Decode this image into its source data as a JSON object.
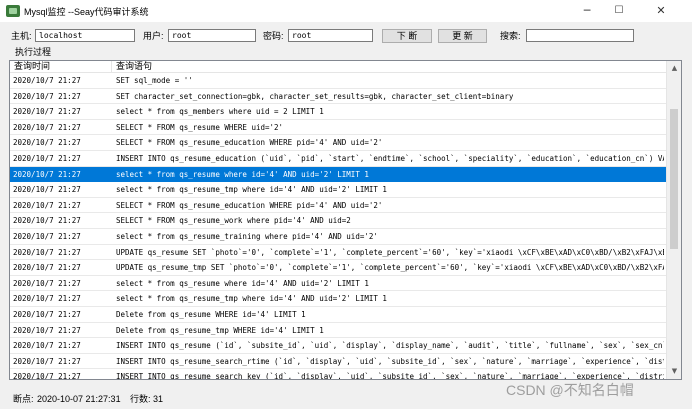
{
  "window": {
    "title": "Mysql监控 --Seay代码审计系统"
  },
  "connection": {
    "host_label": "主机:",
    "host_value": "localhost",
    "user_label": "用户:",
    "user_value": "root",
    "password_label": "密码:",
    "password_value": "root",
    "break_button": "下 断",
    "update_button": "更 新",
    "search_label": "搜索:",
    "search_value": ""
  },
  "log": {
    "section_label": "执行过程",
    "columns": [
      "查询时间",
      "查询语句"
    ],
    "selected_index": 6,
    "rows": [
      {
        "time": "2020/10/7 21:27",
        "sql": "SET sql_mode = ''"
      },
      {
        "time": "2020/10/7 21:27",
        "sql": "SET character_set_connection=gbk, character_set_results=gbk, character_set_client=binary"
      },
      {
        "time": "2020/10/7 21:27",
        "sql": "select * from qs_members where uid = 2 LIMIT 1"
      },
      {
        "time": "2020/10/7 21:27",
        "sql": "SELECT * FROM qs_resume WHERE uid='2'"
      },
      {
        "time": "2020/10/7 21:27",
        "sql": "SELECT * FROM qs_resume_education WHERE  pid='4' AND uid='2'"
      },
      {
        "time": "2020/10/7 21:27",
        "sql": "INSERT INTO qs_resume_education (`uid`, `pid`, `start`, `endtime`, `school`, `speciality`, `education`, `education_cn`) VALUES ('2',..."
      },
      {
        "time": "2020/10/7 21:27",
        "sql": "select * from qs_resume where id='4'  AND uid='2' LIMIT 1"
      },
      {
        "time": "2020/10/7 21:27",
        "sql": "select * from qs_resume_tmp where id='4'  AND uid='2' LIMIT 1"
      },
      {
        "time": "2020/10/7 21:27",
        "sql": "SELECT * FROM qs_resume_education WHERE  pid='4' AND uid='2'"
      },
      {
        "time": "2020/10/7 21:27",
        "sql": "SELECT * FROM qs_resume_work where pid='4' AND uid=2"
      },
      {
        "time": "2020/10/7 21:27",
        "sql": "select * from qs_resume_training where pid='4' AND  uid='2'"
      },
      {
        "time": "2020/10/7 21:27",
        "sql": "UPDATE qs_resume SET `photo`='0', `complete`='1', `complete_percent`='60', `key`='xiaodi \\xCF\\xBE\\xAD\\xC0\\xBD/\\xB2\\xFAJ\\xBE\\xAD\\..."
      },
      {
        "time": "2020/10/7 21:27",
        "sql": "UPDATE qs_resume_tmp SET `photo`='0', `complete`='1', `complete_percent`='60', `key`='xiaodi \\xCF\\xBE\\xAD\\xC0\\xBD/\\xB2\\xFAJ\\xBE\\..."
      },
      {
        "time": "2020/10/7 21:27",
        "sql": "select * from qs_resume where id='4' AND uid='2' LIMIT 1"
      },
      {
        "time": "2020/10/7 21:27",
        "sql": "select * from qs_resume_tmp where id='4' AND uid='2' LIMIT 1"
      },
      {
        "time": "2020/10/7 21:27",
        "sql": "Delete from qs_resume WHERE id='4' LIMIT 1"
      },
      {
        "time": "2020/10/7 21:27",
        "sql": "Delete from qs_resume_tmp WHERE id='4' LIMIT 1"
      },
      {
        "time": "2020/10/7 21:27",
        "sql": "INSERT INTO qs_resume (`id`, `subsite_id`, `uid`, `display`, `display_name`, `audit`, `title`, `fullname`, `sex`, `sex_cn`, `nature`..."
      },
      {
        "time": "2020/10/7 21:27",
        "sql": "INSERT INTO qs_resume_search_rtime (`id`, `display`, `uid`, `subsite_id`, `sex`, `nature`, `marriage`, `experience`, `district`, `sd..."
      },
      {
        "time": "2020/10/7 21:27",
        "sql": "INSERT INTO qs_resume_search_key (`id`, `display`, `uid`, `subsite_id`, `sex`, `nature`, `marriage`, `experience`, `district`, `sdis..."
      }
    ]
  },
  "status": {
    "breakpoint_label": "断点:",
    "breakpoint_value": "2020-10-07 21:27:31",
    "rows_label": "行数:",
    "rows_value": "31"
  },
  "watermark": "CSDN @不知名白帽"
}
